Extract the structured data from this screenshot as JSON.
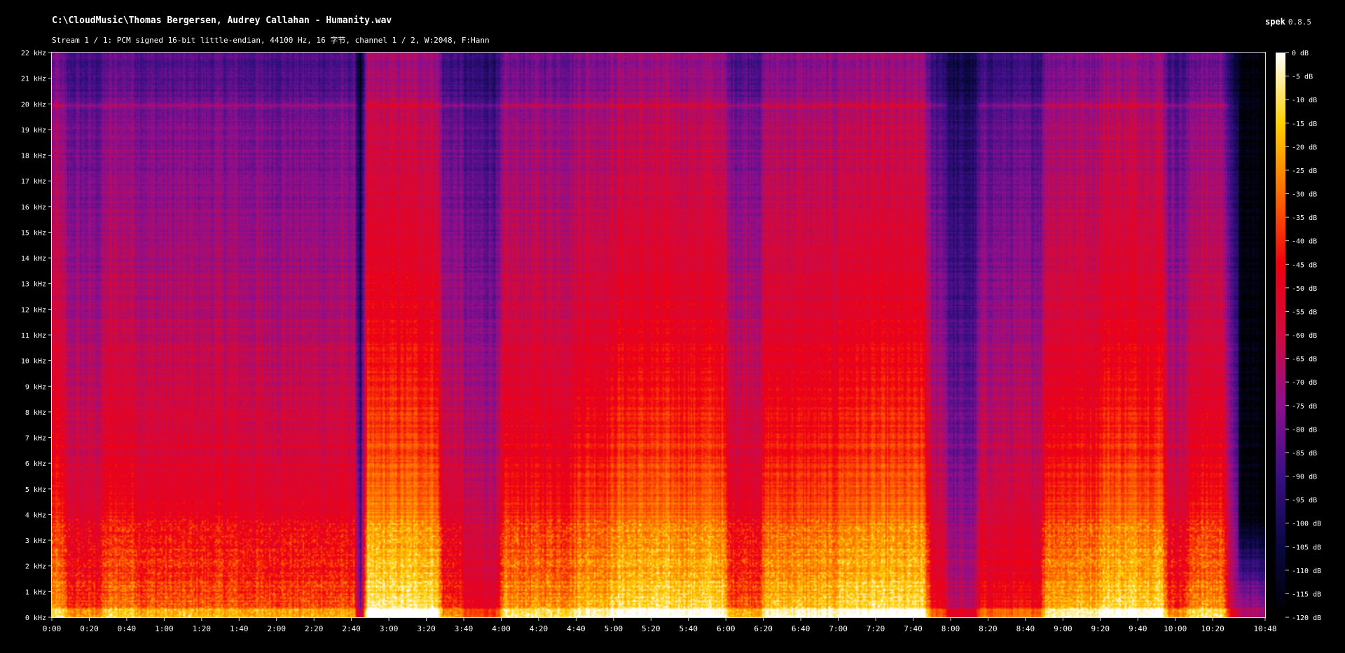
{
  "window": {
    "file_path": "C:\\CloudMusic\\Thomas Bergersen, Audrey Callahan - Humanity.wav",
    "stream_info": "Stream 1 / 1: PCM signed 16-bit little-endian, 44100 Hz, 16 字节, channel 1 / 2, W:2048, F:Hann",
    "app_name": "spek",
    "app_version": "0.8.5"
  },
  "chart_data": {
    "type": "heatmap",
    "x_ticks": [
      "0:00",
      "0:20",
      "0:40",
      "1:00",
      "1:20",
      "1:40",
      "2:00",
      "2:20",
      "2:40",
      "3:00",
      "3:20",
      "3:40",
      "4:00",
      "4:20",
      "4:40",
      "5:00",
      "5:20",
      "5:40",
      "6:00",
      "6:20",
      "6:40",
      "7:00",
      "7:20",
      "7:40",
      "8:00",
      "8:20",
      "8:40",
      "9:00",
      "9:20",
      "9:40",
      "10:00",
      "10:20",
      "10:48"
    ],
    "x_tick_seconds": [
      0,
      20,
      40,
      60,
      80,
      100,
      120,
      140,
      160,
      180,
      200,
      220,
      240,
      260,
      280,
      300,
      320,
      340,
      360,
      380,
      400,
      420,
      440,
      460,
      480,
      500,
      520,
      540,
      560,
      580,
      600,
      620,
      648
    ],
    "duration_seconds": 648,
    "y_ticks": [
      "0 kHz",
      "1 kHz",
      "2 kHz",
      "3 kHz",
      "4 kHz",
      "5 kHz",
      "6 kHz",
      "7 kHz",
      "8 kHz",
      "9 kHz",
      "10 kHz",
      "11 kHz",
      "12 kHz",
      "13 kHz",
      "14 kHz",
      "15 kHz",
      "16 kHz",
      "17 kHz",
      "18 kHz",
      "19 kHz",
      "20 kHz",
      "21 kHz",
      "22 kHz"
    ],
    "y_range_khz": [
      0,
      22
    ],
    "colorbar_ticks": [
      "0 dB",
      "-5 dB",
      "-10 dB",
      "-15 dB",
      "-20 dB",
      "-25 dB",
      "-30 dB",
      "-35 dB",
      "-40 dB",
      "-45 dB",
      "-50 dB",
      "-55 dB",
      "-60 dB",
      "-65 dB",
      "-70 dB",
      "-75 dB",
      "-80 dB",
      "-85 dB",
      "-90 dB",
      "-95 dB",
      "-100 dB",
      "-105 dB",
      "-110 dB",
      "-115 dB",
      "-120 dB"
    ],
    "db_range": [
      -120,
      0
    ],
    "colormap": [
      "#000000",
      "#0a0842",
      "#3a0f86",
      "#8d0f8f",
      "#d10a40",
      "#f00010",
      "#ff6a00",
      "#ffd200",
      "#ffffff"
    ],
    "loudness_segments": [
      {
        "start": 0,
        "end": 6,
        "level": 0.72
      },
      {
        "start": 6,
        "end": 27,
        "level": 0.55
      },
      {
        "start": 27,
        "end": 45,
        "level": 0.68
      },
      {
        "start": 45,
        "end": 100,
        "level": 0.62
      },
      {
        "start": 100,
        "end": 163,
        "level": 0.6
      },
      {
        "start": 163,
        "end": 167,
        "level": 0.1
      },
      {
        "start": 167,
        "end": 207,
        "level": 0.9
      },
      {
        "start": 207,
        "end": 220,
        "level": 0.55
      },
      {
        "start": 220,
        "end": 240,
        "level": 0.45
      },
      {
        "start": 240,
        "end": 280,
        "level": 0.72
      },
      {
        "start": 280,
        "end": 300,
        "level": 0.8
      },
      {
        "start": 300,
        "end": 360,
        "level": 0.86
      },
      {
        "start": 360,
        "end": 380,
        "level": 0.62
      },
      {
        "start": 380,
        "end": 420,
        "level": 0.8
      },
      {
        "start": 420,
        "end": 468,
        "level": 0.86
      },
      {
        "start": 468,
        "end": 478,
        "level": 0.5
      },
      {
        "start": 478,
        "end": 495,
        "level": 0.28
      },
      {
        "start": 495,
        "end": 530,
        "level": 0.52
      },
      {
        "start": 530,
        "end": 560,
        "level": 0.78
      },
      {
        "start": 560,
        "end": 595,
        "level": 0.86
      },
      {
        "start": 595,
        "end": 608,
        "level": 0.55
      },
      {
        "start": 608,
        "end": 628,
        "level": 0.72
      },
      {
        "start": 628,
        "end": 634,
        "level": 0.3
      },
      {
        "start": 634,
        "end": 648,
        "level": 0.05
      }
    ]
  }
}
